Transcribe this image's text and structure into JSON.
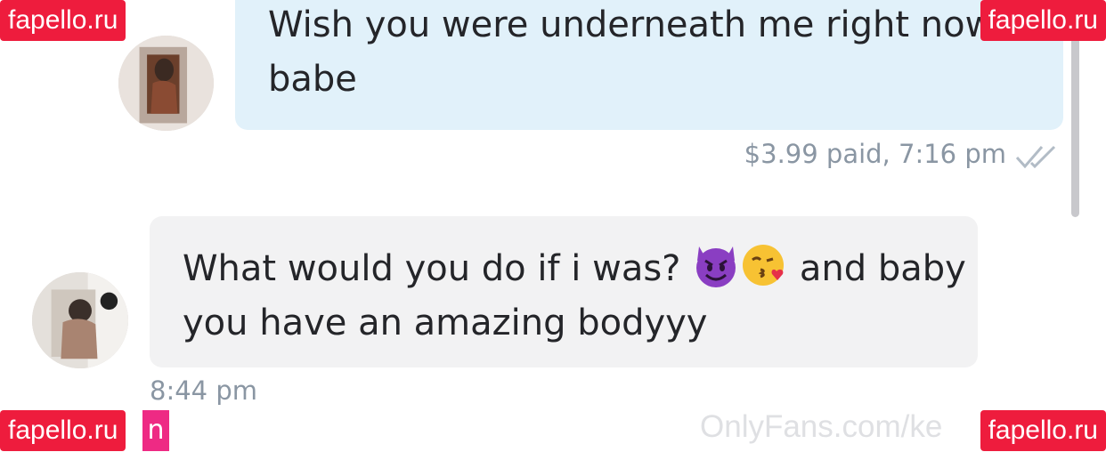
{
  "messages": {
    "outgoing": {
      "text": "Wish you were underneath me right now babe",
      "status": "$3.99 paid,  7:16 pm"
    },
    "incoming": {
      "text_before_emoji": "What would you do if i was?",
      "text_after_emoji": "and baby you have an amazing bodyyy",
      "time": "8:44 pm",
      "emojis": [
        "smiling-face-with-horns",
        "face-blowing-kiss"
      ]
    }
  },
  "watermarks": {
    "tag_text": "fapello.ru",
    "tag_bottom_left_fragment": "n",
    "site_text": "OnlyFans.com/ke"
  },
  "colors": {
    "outgoing_bubble": "#e1f1fa",
    "incoming_bubble": "#f2f2f3",
    "meta_text": "#8a96a3",
    "watermark_tag": "#ee1c3d"
  }
}
